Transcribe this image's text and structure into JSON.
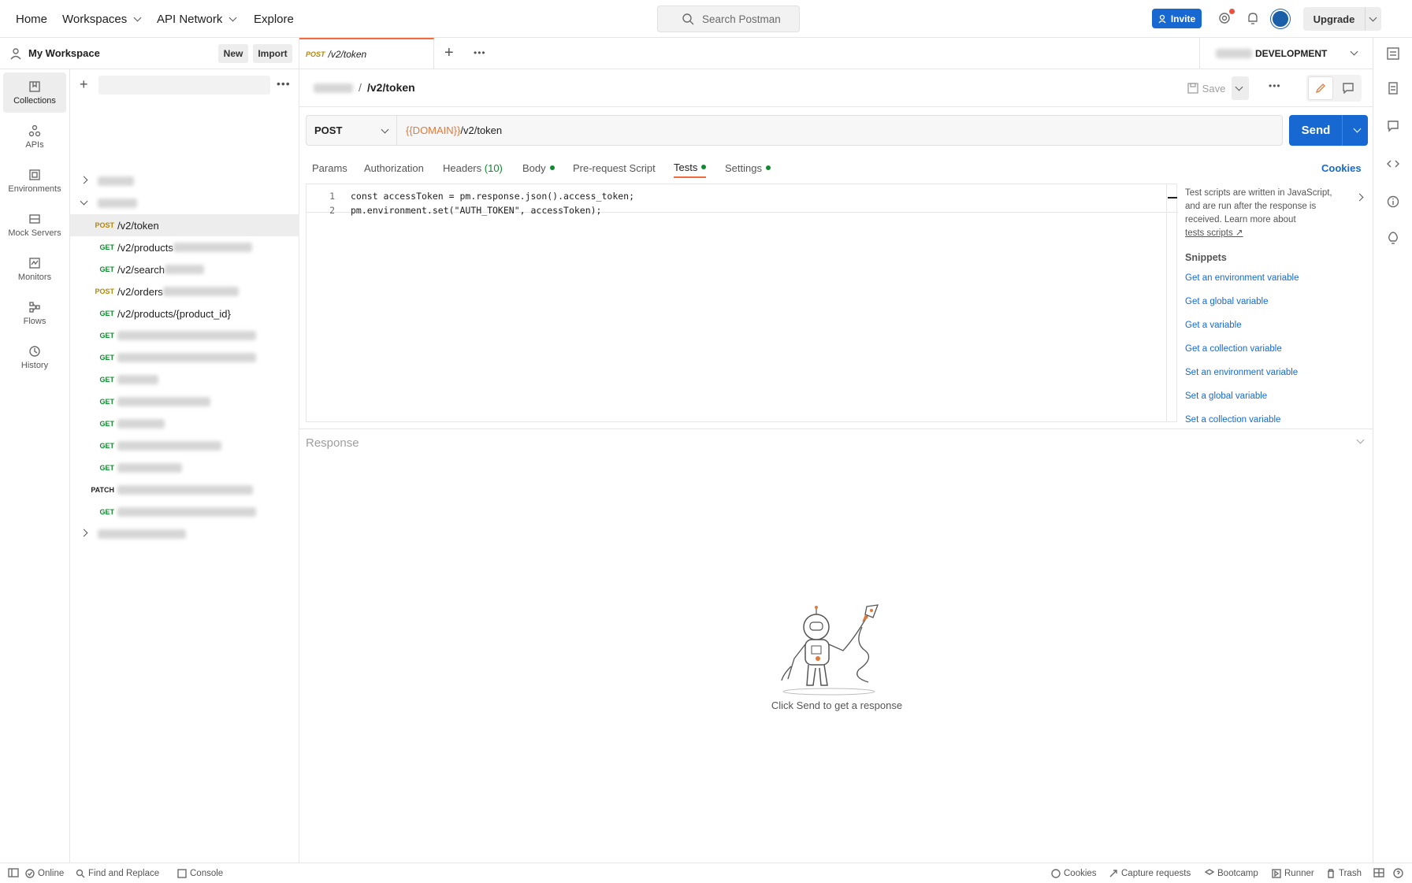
{
  "topnav": {
    "home": "Home",
    "workspaces": "Workspaces",
    "api_network": "API Network",
    "explore": "Explore",
    "search_placeholder": "Search Postman",
    "invite": "Invite",
    "upgrade": "Upgrade"
  },
  "workspace": {
    "name": "My Workspace",
    "new": "New",
    "import": "Import"
  },
  "rail": [
    {
      "label": "Collections",
      "icon": "collections-icon"
    },
    {
      "label": "APIs",
      "icon": "apis-icon"
    },
    {
      "label": "Environments",
      "icon": "environments-icon"
    },
    {
      "label": "Mock Servers",
      "icon": "mock-servers-icon"
    },
    {
      "label": "Monitors",
      "icon": "monitors-icon"
    },
    {
      "label": "Flows",
      "icon": "flows-icon"
    },
    {
      "label": "History",
      "icon": "history-icon"
    }
  ],
  "tree": {
    "requests": [
      {
        "method": "POST",
        "path": "/v2/token"
      },
      {
        "method": "GET",
        "path": "/v2/products"
      },
      {
        "method": "GET",
        "path": "/v2/search"
      },
      {
        "method": "POST",
        "path": "/v2/orders"
      },
      {
        "method": "GET",
        "path": "/v2/products/{product_id}"
      },
      {
        "method": "GET",
        "path": ""
      },
      {
        "method": "GET",
        "path": ""
      },
      {
        "method": "GET",
        "path": ""
      },
      {
        "method": "GET",
        "path": ""
      },
      {
        "method": "GET",
        "path": ""
      },
      {
        "method": "GET",
        "path": ""
      },
      {
        "method": "GET",
        "path": ""
      },
      {
        "method": "PATCH",
        "path": ""
      },
      {
        "method": "GET",
        "path": ""
      }
    ]
  },
  "tab": {
    "method": "POST",
    "title": "/v2/token"
  },
  "environment": {
    "name": "DEVELOPMENT"
  },
  "breadcrumb": {
    "separator": "/",
    "current": "/v2/token",
    "save": "Save"
  },
  "request": {
    "method": "POST",
    "url_var": "{{DOMAIN}}",
    "url_path": "/v2/token",
    "send": "Send"
  },
  "request_tabs": {
    "params": "Params",
    "authorization": "Authorization",
    "headers": "Headers",
    "headers_count": "(10)",
    "body": "Body",
    "prerequest": "Pre-request Script",
    "tests": "Tests",
    "settings": "Settings",
    "cookies": "Cookies"
  },
  "editor": {
    "lines": [
      {
        "n": "1",
        "code": "const accessToken = pm.response.json().access_token;"
      },
      {
        "n": "2",
        "code": "pm.environment.set(\"AUTH_TOKEN\", accessToken);"
      }
    ]
  },
  "snippets_panel": {
    "intro": "Test scripts are written in JavaScript, and are run after the response is received. Learn more about",
    "link": "tests scripts ↗",
    "heading": "Snippets",
    "items": [
      "Get an environment variable",
      "Get a global variable",
      "Get a variable",
      "Get a collection variable",
      "Set an environment variable",
      "Set a global variable",
      "Set a collection variable"
    ]
  },
  "response": {
    "label": "Response",
    "empty_text": "Click Send to get a response"
  },
  "statusbar": {
    "online": "Online",
    "find_replace": "Find and Replace",
    "console": "Console",
    "cookies": "Cookies",
    "capture": "Capture requests",
    "bootcamp": "Bootcamp",
    "runner": "Runner",
    "trash": "Trash"
  },
  "colors": {
    "accent": "#1769d1",
    "tab_active": "#f26b3a",
    "get": "#0f8a2e",
    "post": "#b68603"
  }
}
